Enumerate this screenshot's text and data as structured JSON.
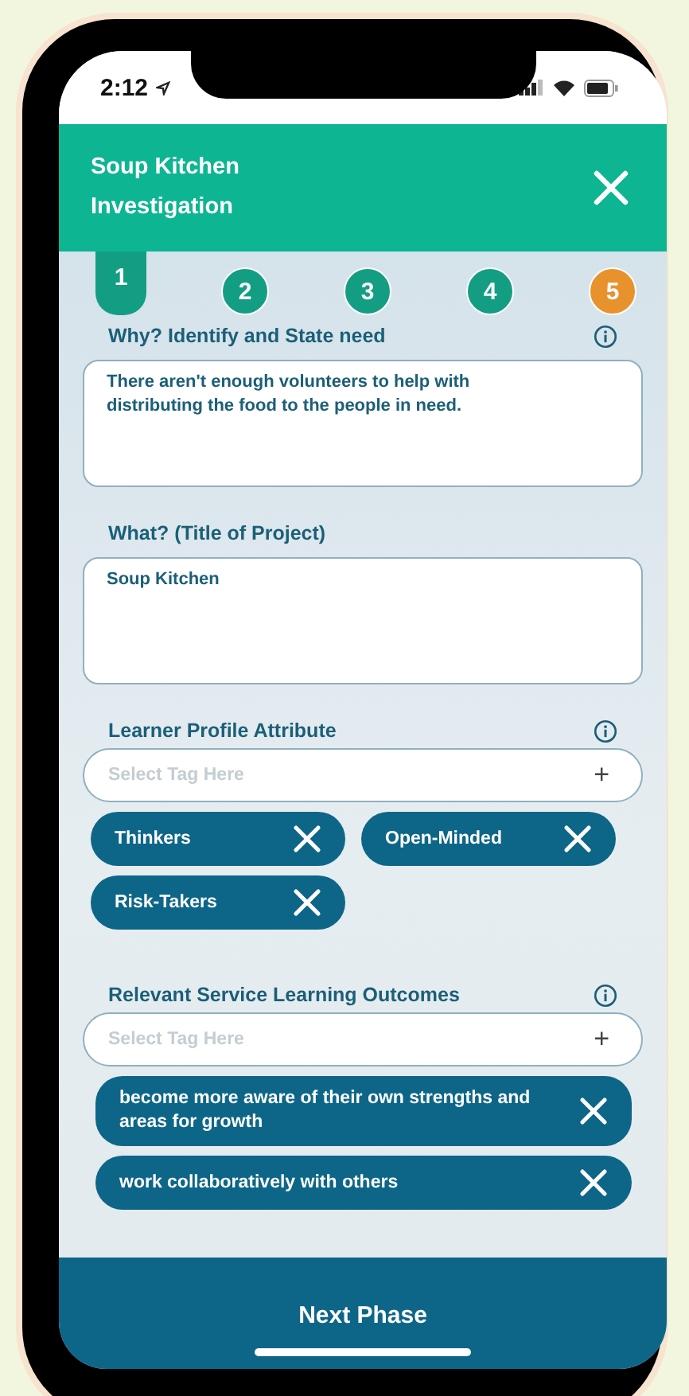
{
  "status_bar": {
    "time": "2:12"
  },
  "header": {
    "title": "Soup Kitchen Investigation"
  },
  "steps": [
    {
      "label": "1",
      "selected": true,
      "color": "#139e84"
    },
    {
      "label": "2",
      "selected": false,
      "color": "#139e84"
    },
    {
      "label": "3",
      "selected": false,
      "color": "#139e84"
    },
    {
      "label": "4",
      "selected": false,
      "color": "#139e84"
    },
    {
      "label": "5",
      "selected": false,
      "color": "#e8922e"
    }
  ],
  "sections": [
    {
      "kind": "text",
      "label": "Why? Identify and State need",
      "info": true,
      "value": "There aren't enough volunteers to help with distributing the food to the people in need."
    },
    {
      "kind": "text",
      "label": "What? (Title of Project)",
      "info": false,
      "value": "Soup Kitchen"
    },
    {
      "kind": "tag-grid",
      "label": "Learner Profile Attribute",
      "info": true,
      "placeholder": "Select Tag Here",
      "add": "+",
      "tags": [
        "Thinkers",
        "Open-Minded",
        "Risk-Takers"
      ]
    },
    {
      "kind": "tag-list",
      "label": "Relevant Service Learning Outcomes",
      "info": true,
      "placeholder": "Select Tag Here",
      "add": "+",
      "tags": [
        "become more aware of their own strengths and areas for growth",
        "work collaboratively with others"
      ]
    }
  ],
  "footer": {
    "button": "Next Phase"
  }
}
